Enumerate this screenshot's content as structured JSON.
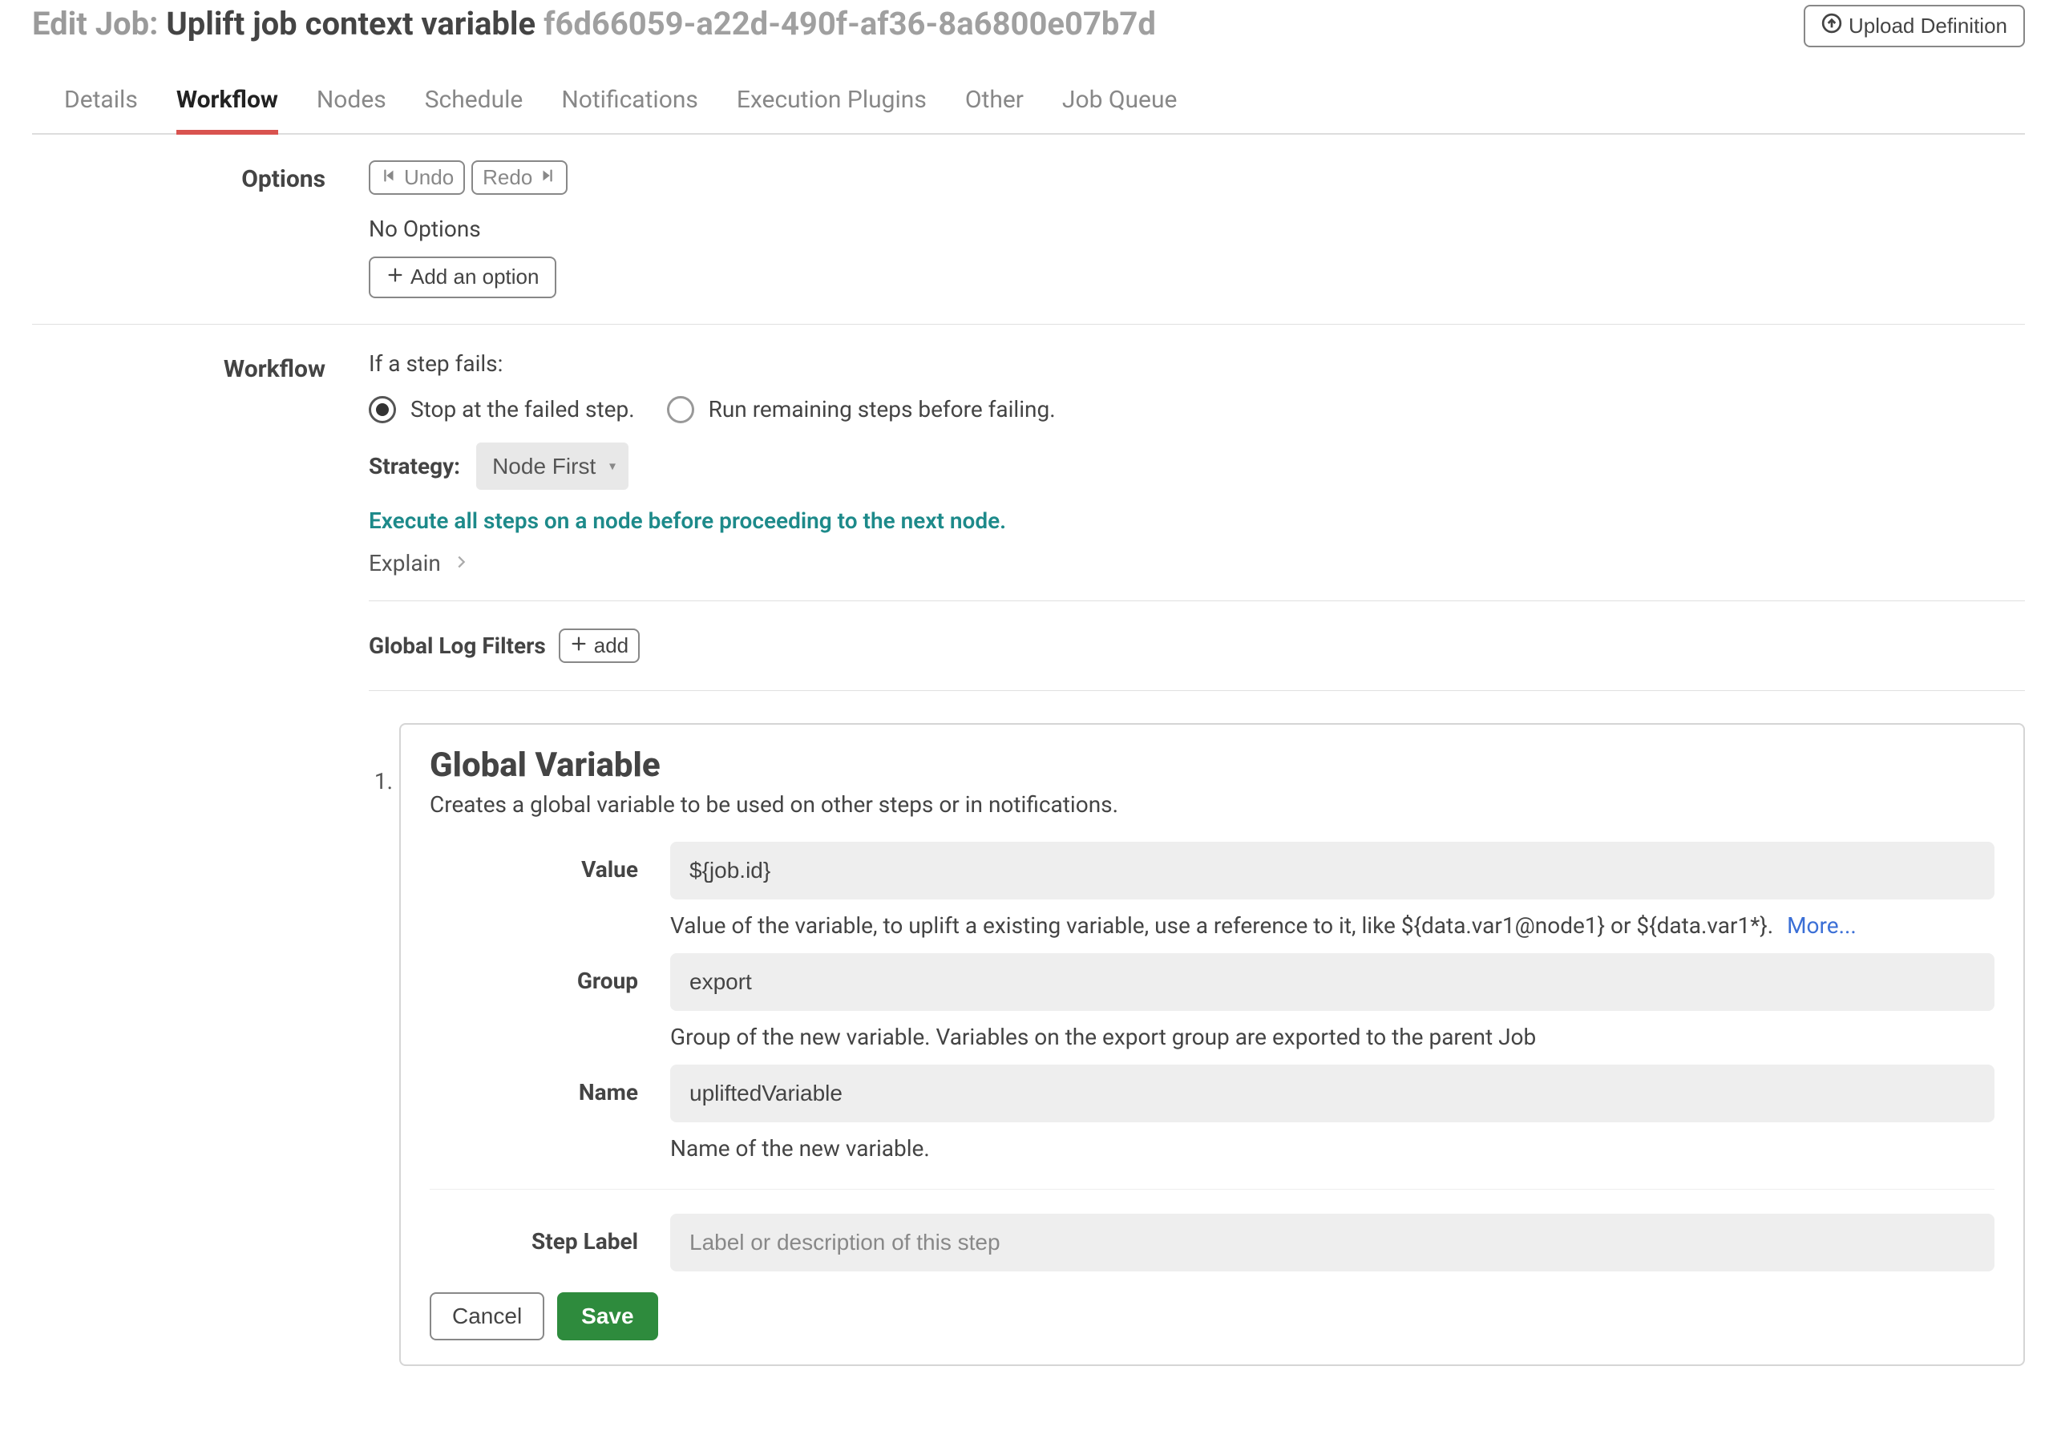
{
  "header": {
    "prefix": "Edit Job:",
    "title": "Uplift job context variable",
    "uuid": "f6d66059-a22d-490f-af36-8a6800e07b7d",
    "upload_label": "Upload Definition"
  },
  "tabs": [
    "Details",
    "Workflow",
    "Nodes",
    "Schedule",
    "Notifications",
    "Execution Plugins",
    "Other",
    "Job Queue"
  ],
  "active_tab": "Workflow",
  "options": {
    "section_label": "Options",
    "undo": "Undo",
    "redo": "Redo",
    "no_options": "No Options",
    "add_option": "Add an option"
  },
  "workflow": {
    "section_label": "Workflow",
    "fail_prompt": "If a step fails:",
    "radio_stop": "Stop at the failed step.",
    "radio_continue": "Run remaining steps before failing.",
    "radio_selected": "stop",
    "strategy_label": "Strategy:",
    "strategy_value": "Node First",
    "strategy_hint": "Execute all steps on a node before proceeding to the next node.",
    "explain": "Explain",
    "log_filters_label": "Global Log Filters",
    "log_filters_add": "add"
  },
  "step": {
    "index": "1.",
    "title": "Global Variable",
    "description": "Creates a global variable to be used on other steps or in notifications.",
    "fields": {
      "value": {
        "label": "Value",
        "value": "${job.id}",
        "help": "Value of the variable, to uplift a existing variable, use a reference to it, like ${data.var1@node1} or ${data.var1*}.",
        "more": "More..."
      },
      "group": {
        "label": "Group",
        "value": "export",
        "help": "Group of the new variable. Variables on the export group are exported to the parent Job"
      },
      "name": {
        "label": "Name",
        "value": "upliftedVariable",
        "help": "Name of the new variable."
      },
      "step_label": {
        "label": "Step Label",
        "placeholder": "Label or description of this step"
      }
    },
    "cancel": "Cancel",
    "save": "Save"
  }
}
